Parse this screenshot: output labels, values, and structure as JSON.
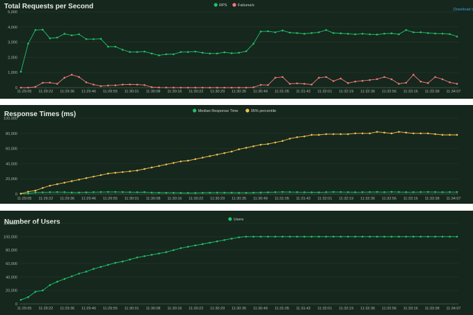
{
  "download_label": "Download data",
  "x_ticks": [
    "11:29:05",
    "11:29:22",
    "11:29:36",
    "11:29:46",
    "11:29:55",
    "11:30:01",
    "11:30:08",
    "11:30:16",
    "11:30:22",
    "11:30:29",
    "11:30:35",
    "11:30:49",
    "11:31:05",
    "11:31:42",
    "11:32:01",
    "11:32:19",
    "11:32:36",
    "11:32:56",
    "11:33:16",
    "11:33:38",
    "11:34:07"
  ],
  "chart_data": [
    {
      "type": "line",
      "title": "Total Requests per Second",
      "ylim": [
        0,
        5000
      ],
      "y_ticks": [
        0,
        1000,
        2000,
        3000,
        4000,
        5000
      ],
      "series": [
        {
          "name": "RPS",
          "color": "#1fc36b",
          "values": [
            1050,
            2900,
            3800,
            3820,
            3250,
            3300,
            3550,
            3450,
            3520,
            3200,
            3200,
            3220,
            2700,
            2700,
            2500,
            2350,
            2350,
            2380,
            2250,
            2130,
            2200,
            2200,
            2350,
            2350,
            2380,
            2300,
            2250,
            2250,
            2330,
            2270,
            2300,
            2400,
            2900,
            3700,
            3720,
            3650,
            3770,
            3630,
            3600,
            3550,
            3600,
            3650,
            3800,
            3600,
            3580,
            3550,
            3520,
            3550,
            3520,
            3500,
            3560,
            3580,
            3520,
            3800,
            3650,
            3650,
            3600,
            3570,
            3560,
            3530,
            3370
          ]
        },
        {
          "name": "Failures/s",
          "color": "#f07a7a",
          "values": [
            0,
            0,
            50,
            320,
            330,
            250,
            650,
            850,
            700,
            350,
            200,
            100,
            140,
            150,
            200,
            210,
            200,
            170,
            30,
            10,
            5,
            5,
            0,
            0,
            0,
            0,
            0,
            0,
            0,
            0,
            0,
            0,
            20,
            180,
            170,
            650,
            700,
            250,
            280,
            250,
            200,
            650,
            700,
            430,
            600,
            300,
            400,
            450,
            500,
            560,
            700,
            550,
            250,
            320,
            850,
            400,
            300,
            700,
            550,
            350,
            250
          ]
        }
      ]
    },
    {
      "type": "line",
      "title": "Response Times (ms)",
      "ylim": [
        0,
        100000
      ],
      "y_ticks": [
        0,
        20000,
        40000,
        60000,
        80000,
        100000
      ],
      "series": [
        {
          "name": "Median Response Time",
          "color": "#1fc36b",
          "values": [
            500,
            600,
            2000,
            2200,
            2500,
            2600,
            2500,
            2000,
            2000,
            2200,
            2500,
            2600,
            2700,
            2700,
            2600,
            2500,
            2400,
            2500,
            1900,
            1800,
            1700,
            1700,
            1600,
            1500,
            1600,
            1700,
            1800,
            1900,
            1800,
            1800,
            1700,
            1700,
            1800,
            2000,
            2300,
            2500,
            2700,
            2600,
            2500,
            2400,
            2300,
            2200,
            2500,
            2700,
            2600,
            2500,
            2400,
            2500,
            2600,
            2700,
            2500,
            2800,
            2600,
            2500,
            2500,
            2600,
            2700,
            2600,
            2500,
            2600,
            2600
          ]
        },
        {
          "name": "95% percentile",
          "color": "#f1c24e",
          "values": [
            500,
            3000,
            4500,
            8000,
            11000,
            13000,
            15000,
            17000,
            19000,
            21000,
            23000,
            25000,
            27000,
            28000,
            29000,
            30000,
            31000,
            33000,
            35000,
            37000,
            39000,
            41000,
            43000,
            44000,
            46000,
            48000,
            50000,
            52000,
            54000,
            56000,
            59000,
            61000,
            63000,
            65000,
            66000,
            68000,
            70000,
            73000,
            75000,
            76000,
            78000,
            78000,
            79000,
            79000,
            79000,
            79000,
            80000,
            80000,
            80000,
            82000,
            81000,
            80000,
            82000,
            81000,
            80000,
            80000,
            80000,
            79000,
            78000,
            78000,
            78000
          ]
        }
      ]
    },
    {
      "type": "line",
      "title": "Number of Users",
      "ylim": [
        0,
        120000
      ],
      "y_ticks": [
        0,
        20000,
        40000,
        60000,
        80000,
        100000,
        120000
      ],
      "series": [
        {
          "name": "Users",
          "color": "#1fc36b",
          "values": [
            6000,
            10000,
            18000,
            20000,
            28000,
            33000,
            37000,
            41000,
            45000,
            48000,
            52000,
            55000,
            58000,
            61000,
            63000,
            66000,
            69000,
            71000,
            73000,
            75000,
            77000,
            80000,
            83000,
            85000,
            87000,
            89000,
            91000,
            93000,
            95000,
            97000,
            99000,
            100000,
            100000,
            100000,
            100000,
            100000,
            100000,
            100000,
            100000,
            100000,
            100000,
            100000,
            100000,
            100000,
            100000,
            100000,
            100000,
            100000,
            100000,
            100000,
            100000,
            100000,
            100000,
            100000,
            100000,
            100000,
            100000,
            100000,
            100000,
            100000,
            100000
          ]
        }
      ]
    }
  ]
}
